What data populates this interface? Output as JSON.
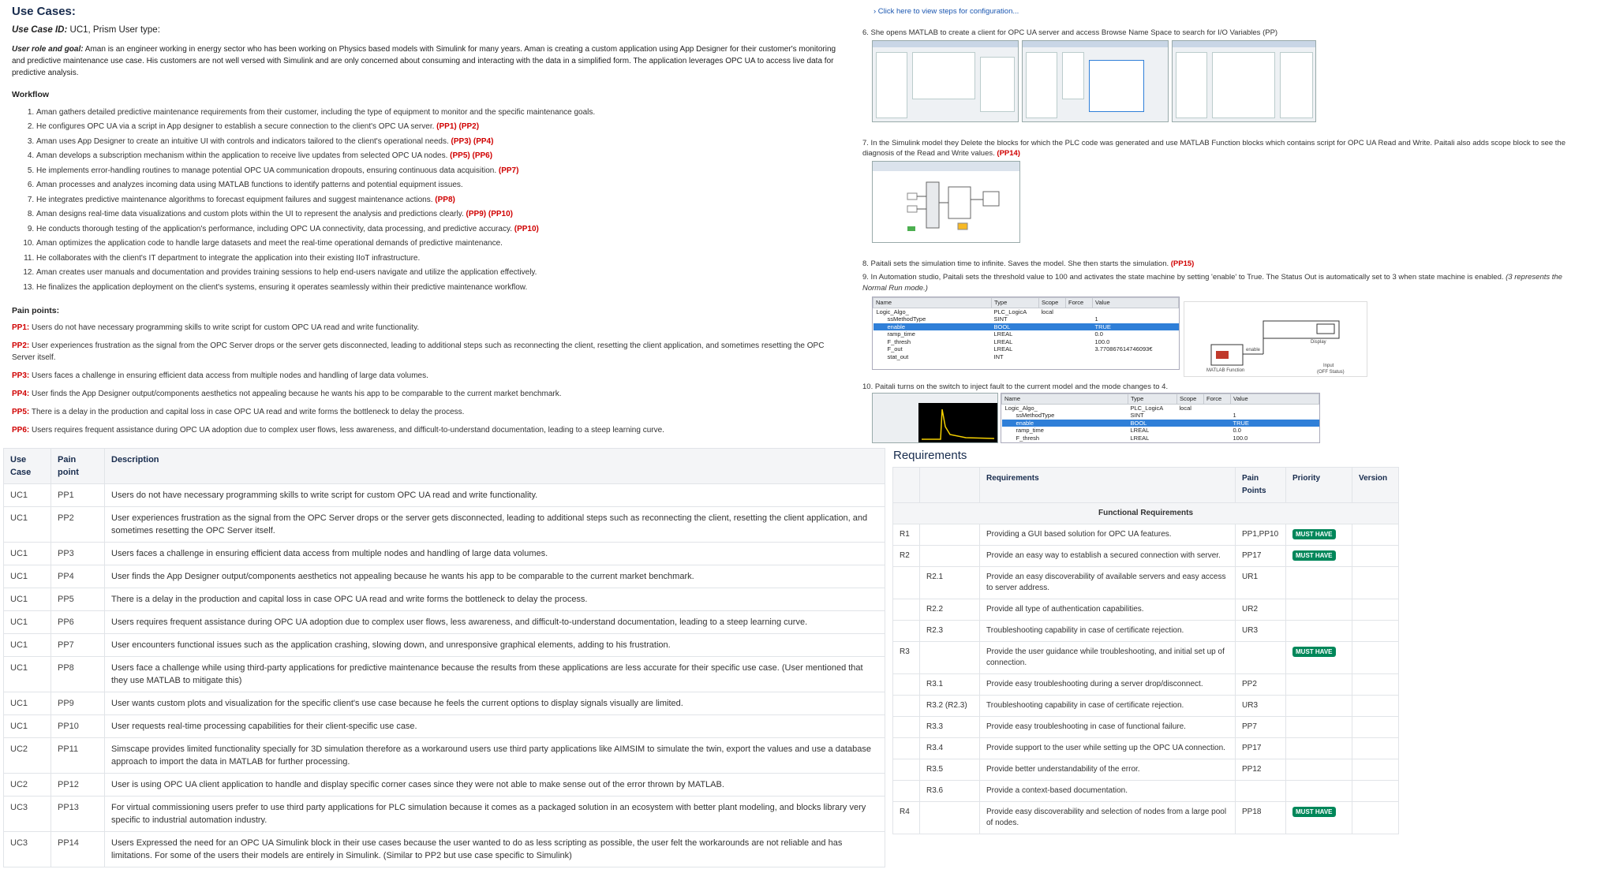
{
  "use_case_doc": {
    "title": "Use Cases:",
    "id_label": "Use Case ID:",
    "id_value": " UC1, Prism User type:",
    "goal_label": "User role and goal:",
    "goal_text": " Aman is an engineer working in energy sector who has been working on Physics based models with Simulink for many years. Aman is creating a custom application using App Designer for their customer's monitoring and predictive maintenance use case. His customers are not well versed with Simulink and are only concerned about consuming and interacting with the data in a simplified form. The application leverages OPC UA to access live data for predictive analysis.",
    "workflow_heading": "Workflow",
    "workflow": [
      {
        "text": "Aman gathers detailed predictive maintenance requirements from their customer, including the type of equipment to monitor and the specific maintenance goals.",
        "tags": ""
      },
      {
        "text": "He configures OPC UA via a script in App designer to establish a secure connection to the client's OPC UA server.",
        "tags": "(PP1) (PP2)"
      },
      {
        "text": "Aman uses App Designer to create an intuitive UI with controls and indicators tailored to the client's operational needs.",
        "tags": "(PP3) (PP4)"
      },
      {
        "text": "Aman develops a subscription mechanism within the application to receive live updates from selected OPC UA nodes.",
        "tags": "(PP5) (PP6)"
      },
      {
        "text": "He implements error-handling routines to manage potential OPC UA communication dropouts, ensuring continuous data acquisition.",
        "tags": "(PP7)"
      },
      {
        "text": "Aman processes and analyzes incoming data using MATLAB functions to identify patterns and potential equipment issues.",
        "tags": ""
      },
      {
        "text": "He integrates predictive maintenance algorithms to forecast equipment failures and suggest maintenance actions.",
        "tags": "(PP8)"
      },
      {
        "text": "Aman designs real-time data visualizations and custom plots within the UI to represent the analysis and predictions clearly.",
        "tags": "(PP9) (PP10)"
      },
      {
        "text": "He conducts thorough testing of the application's performance, including OPC UA connectivity, data processing, and predictive accuracy.",
        "tags": "(PP10)"
      },
      {
        "text": "Aman optimizes the application code to handle large datasets and meet the real-time operational demands of predictive maintenance.",
        "tags": ""
      },
      {
        "text": "He collaborates with the client's IT department to integrate the application into their existing IIoT infrastructure.",
        "tags": ""
      },
      {
        "text": "Aman creates user manuals and documentation and provides training sessions to help end-users navigate and utilize the application effectively.",
        "tags": ""
      },
      {
        "text": "He finalizes the application deployment on the client's systems, ensuring it operates seamlessly within their predictive maintenance workflow.",
        "tags": ""
      }
    ],
    "pain_heading": "Pain points:",
    "pain_points": [
      {
        "code": "PP1:",
        "text": " Users do not have necessary programming skills to write script for custom OPC UA read and write functionality."
      },
      {
        "code": "PP2:",
        "text": " User experiences frustration as the signal from the OPC Server drops or the server gets disconnected, leading to additional steps such as reconnecting the client, resetting the client application, and sometimes resetting the OPC Server itself."
      },
      {
        "code": "PP3:",
        "text": " Users faces a challenge in ensuring efficient data access from multiple nodes and handling of large data volumes."
      },
      {
        "code": "PP4:",
        "text": " User finds the App Designer output/components aesthetics not appealing because he wants his app to be comparable to the current market benchmark."
      },
      {
        "code": "PP5:",
        "text": " There is a delay in the production and capital loss in case OPC UA read and write forms the bottleneck to delay the process."
      },
      {
        "code": "PP6:",
        "text": " Users requires frequent assistance during OPC UA adoption due to complex user flows, less awareness, and difficult-to-understand documentation, leading to a steep learning curve."
      }
    ]
  },
  "pp_table": {
    "headers": [
      "Use Case",
      "Pain point",
      "Description"
    ],
    "rows": [
      [
        "UC1",
        "PP1",
        "Users do not have necessary programming skills to write script for custom OPC UA read and write functionality."
      ],
      [
        "UC1",
        "PP2",
        "User experiences frustration as the signal from the OPC Server drops or the server gets disconnected, leading to additional steps such as reconnecting the client, resetting the client application, and sometimes resetting the OPC Server itself."
      ],
      [
        "UC1",
        "PP3",
        "Users faces a challenge in ensuring efficient data access from multiple nodes and handling of large data volumes."
      ],
      [
        "UC1",
        "PP4",
        "User finds the App Designer output/components aesthetics not appealing because he wants his app to be comparable to the current market benchmark."
      ],
      [
        "UC1",
        "PP5",
        "There is a delay in the production and capital loss in case OPC UA read and write forms the bottleneck to delay the process."
      ],
      [
        "UC1",
        "PP6",
        "Users requires frequent assistance during OPC UA adoption due to complex user flows, less awareness, and difficult-to-understand documentation, leading to a steep learning curve."
      ],
      [
        "UC1",
        "PP7",
        "User encounters functional issues such as the application crashing, slowing down, and unresponsive graphical elements, adding to his frustration."
      ],
      [
        "UC1",
        "PP8",
        "Users face a challenge while using third-party applications for predictive maintenance because the results from these applications are less accurate for their specific use case. (User mentioned that they use MATLAB to mitigate this)"
      ],
      [
        "UC1",
        "PP9",
        "User wants custom plots and visualization for the specific client's use case because he feels the current options to display signals visually are limited."
      ],
      [
        "UC1",
        "PP10",
        "User requests real-time processing capabilities for their client-specific use case."
      ],
      [
        "UC2",
        "PP11",
        "Simscape provides limited functionality specially for 3D simulation therefore as a workaround users use third party applications like AIMSIM to simulate the twin, export the values and use a database approach to import the data in MATLAB for further processing."
      ],
      [
        "UC2",
        "PP12",
        "User is using OPC UA client application to handle and display specific corner cases since they were not able to make sense out of the error thrown by MATLAB."
      ],
      [
        "UC3",
        "PP13",
        "For virtual commissioning users prefer to use third party applications for PLC simulation because it comes as a packaged solution in an ecosystem with better plant modeling, and blocks library very specific to industrial automation industry."
      ],
      [
        "UC3",
        "PP14",
        "Users Expressed the need for an OPC UA Simulink block in their use cases because the user wanted to do as less scripting as possible, the user felt the workarounds are not reliable and has limitations. For some of the users their models are entirely in Simulink. (Similar to PP2 but use case specific to Simulink)"
      ]
    ]
  },
  "steps": {
    "expand_link": "› Click here to view steps for configuration...",
    "s6": "6. She opens MATLAB to create a client for OPC UA server and access Browse Name Space to search for I/O Variables (PP)",
    "s7": "7. In the Simulink model they Delete the blocks for which the PLC code was generated and use MATLAB Function blocks which contains script for OPC UA Read and Write. Paitali also adds scope block to see the diagnosis of the Read and Write values.",
    "s7_tag": "(PP14)",
    "s8": "8. Paitali sets the simulation time to infinite. Saves the model. She then starts the simulation.",
    "s8_tag": "(PP15)",
    "s9": "9. In Automation studio, Paitali sets the threshold value to 100 and activates the state machine by setting 'enable' to True. The Status Out is automatically set to 3 when state machine is enabled.",
    "s9_note": "(3 represents the Normal Run mode.)",
    "s10": "10. Paitali turns on the switch to inject fault to the current model and the mode changes to 4.",
    "grid1": {
      "headers": [
        "Name",
        "Type",
        "Scope",
        "Force",
        "Value"
      ],
      "rows": [
        [
          "Logic_Algo_",
          "PLC_LogicA",
          "local",
          "",
          ""
        ],
        [
          "ssMethodType",
          "SINT",
          "",
          "",
          "1"
        ],
        [
          "enable",
          "BOOL",
          "",
          "",
          "TRUE"
        ],
        [
          "ramp_time",
          "LREAL",
          "",
          "",
          "0.0"
        ],
        [
          "F_thresh",
          "LREAL",
          "",
          "",
          "100.0"
        ],
        [
          "F_out",
          "LREAL",
          "",
          "",
          "3.770867614746093€"
        ],
        [
          "stat_out",
          "INT",
          "",
          "",
          ""
        ]
      ]
    },
    "grid2": {
      "headers": [
        "Name",
        "Type",
        "Scope",
        "Force",
        "Value"
      ],
      "rows": [
        [
          "Logic_Algo_",
          "PLC_LogicA",
          "local",
          "",
          ""
        ],
        [
          "ssMethodType",
          "SINT",
          "",
          "",
          "1"
        ],
        [
          "enable",
          "BOOL",
          "",
          "",
          "TRUE"
        ],
        [
          "ramp_time",
          "LREAL",
          "",
          "",
          "0.0"
        ],
        [
          "F_thresh",
          "LREAL",
          "",
          "",
          "100.0"
        ]
      ]
    },
    "diagram_labels": {
      "display": "Display",
      "matlab_fn": "MATLAB Function",
      "enable": "enable",
      "input": "Input",
      "off_status": "(OFF Status)"
    }
  },
  "requirements": {
    "title": "Requirements",
    "headers": [
      "",
      "",
      "Requirements",
      "Pain Points",
      "Priority",
      "Version"
    ],
    "group_label": "Functional Requirements",
    "rows": [
      {
        "id": "R1",
        "sub": "",
        "text": "Providing a GUI based solution for OPC UA features.",
        "pp": "PP1,PP10",
        "priority": "MUST HAVE"
      },
      {
        "id": "R2",
        "sub": "",
        "text": "Provide an easy way to establish a secured connection with server.",
        "pp": "PP17",
        "priority": "MUST HAVE"
      },
      {
        "id": "",
        "sub": "R2.1",
        "text": "Provide an easy discoverability of available servers and easy access to server address.",
        "pp": "UR1",
        "priority": ""
      },
      {
        "id": "",
        "sub": "R2.2",
        "text": "Provide all type of authentication capabilities.",
        "pp": "UR2",
        "priority": ""
      },
      {
        "id": "",
        "sub": "R2.3",
        "text": "Troubleshooting capability in case of certificate rejection.",
        "pp": "UR3",
        "priority": ""
      },
      {
        "id": "R3",
        "sub": "",
        "text": "Provide the user guidance while troubleshooting, and initial set up of connection.",
        "pp": "",
        "priority": "MUST HAVE"
      },
      {
        "id": "",
        "sub": "R3.1",
        "text": "Provide easy troubleshooting during a server drop/disconnect.",
        "pp": "PP2",
        "priority": ""
      },
      {
        "id": "",
        "sub": "R3.2 (R2.3)",
        "text": "Troubleshooting capability in case of certificate rejection.",
        "pp": "UR3",
        "priority": ""
      },
      {
        "id": "",
        "sub": "R3.3",
        "text": "Provide easy troubleshooting in case of functional failure.",
        "pp": "PP7",
        "priority": ""
      },
      {
        "id": "",
        "sub": "R3.4",
        "text": "Provide support to the user while setting up the OPC UA connection.",
        "pp": "PP17",
        "priority": ""
      },
      {
        "id": "",
        "sub": "R3.5",
        "text": "Provide better understandability of the error.",
        "pp": "PP12",
        "priority": ""
      },
      {
        "id": "",
        "sub": "R3.6",
        "text": "Provide a context-based documentation.",
        "pp": "",
        "priority": ""
      },
      {
        "id": "R4",
        "sub": "",
        "text": "Provide easy discoverability and selection of nodes from a large pool of nodes.",
        "pp": "PP18",
        "priority": "MUST HAVE"
      }
    ]
  }
}
